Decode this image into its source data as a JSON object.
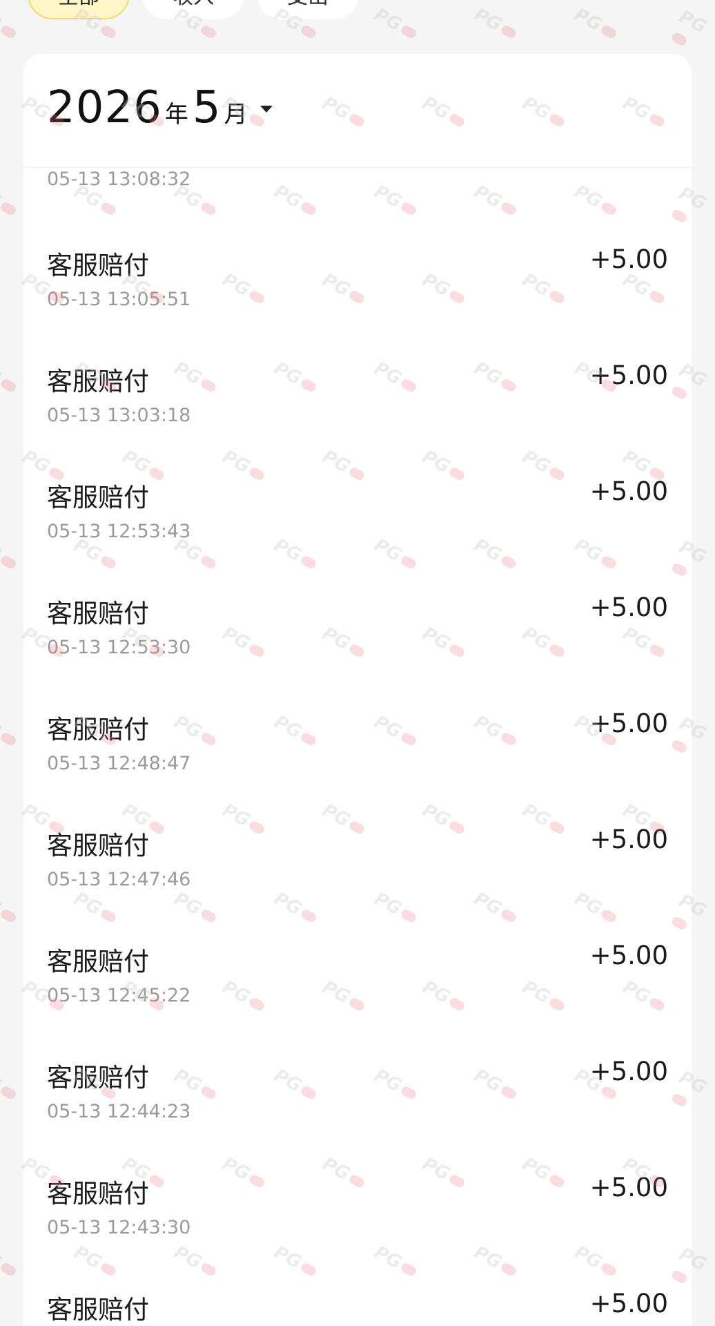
{
  "tabs": [
    {
      "label": "全部",
      "active": true
    },
    {
      "label": "收入",
      "active": false
    },
    {
      "label": "支出",
      "active": false
    }
  ],
  "header": {
    "year": "2026",
    "year_unit": "年",
    "month": "5",
    "month_unit": "月"
  },
  "cut_row_time": "05-13 13:08:32",
  "transactions": [
    {
      "title": "客服赔付",
      "time": "05-13 13:05:51",
      "amount": "+5.00"
    },
    {
      "title": "客服赔付",
      "time": "05-13 13:03:18",
      "amount": "+5.00"
    },
    {
      "title": "客服赔付",
      "time": "05-13 12:53:43",
      "amount": "+5.00"
    },
    {
      "title": "客服赔付",
      "time": "05-13 12:53:30",
      "amount": "+5.00"
    },
    {
      "title": "客服赔付",
      "time": "05-13 12:48:47",
      "amount": "+5.00"
    },
    {
      "title": "客服赔付",
      "time": "05-13 12:47:46",
      "amount": "+5.00"
    },
    {
      "title": "客服赔付",
      "time": "05-13 12:45:22",
      "amount": "+5.00"
    },
    {
      "title": "客服赔付",
      "time": "05-13 12:44:23",
      "amount": "+5.00"
    },
    {
      "title": "客服赔付",
      "time": "05-13 12:43:30",
      "amount": "+5.00"
    },
    {
      "title": "客服赔付",
      "time": "",
      "amount": "+5.00"
    }
  ],
  "watermark_text": "PG"
}
